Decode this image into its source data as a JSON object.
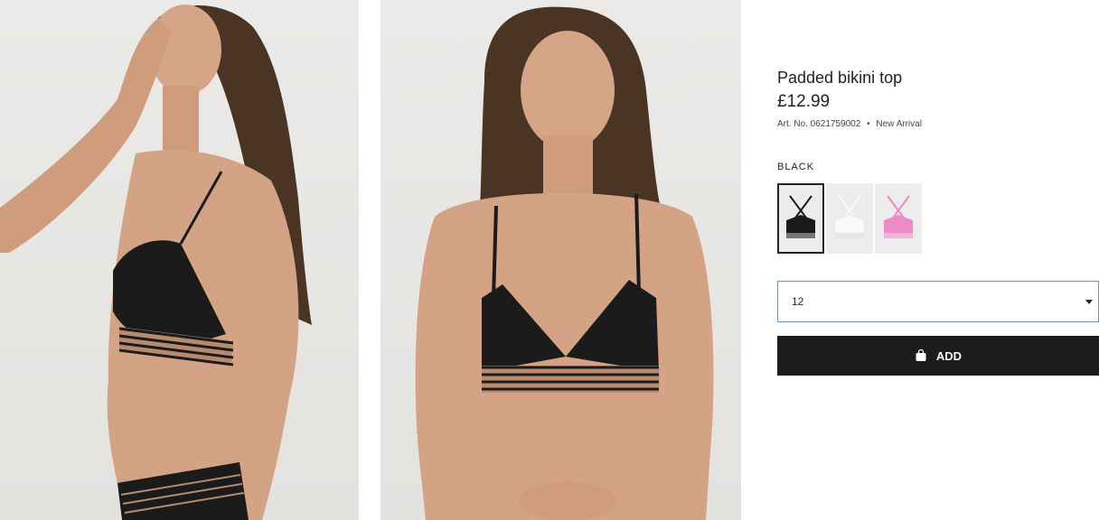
{
  "product": {
    "title": "Padded bikini top",
    "price": "£12.99",
    "article_number": "Art. No. 0621759002",
    "separator": "•",
    "badge": "New Arrival"
  },
  "color": {
    "selected_label": "BLACK",
    "swatches": [
      {
        "name": "black",
        "hex": "#1a1a1a",
        "selected": true
      },
      {
        "name": "white",
        "hex": "#f4f4f4",
        "selected": false
      },
      {
        "name": "pink",
        "hex": "#f08ac6",
        "selected": false
      }
    ]
  },
  "size": {
    "selected_value": "12"
  },
  "cart": {
    "add_label": "ADD",
    "icon": "shopping-bag-icon"
  },
  "images": [
    {
      "name": "model-side-view-photo"
    },
    {
      "name": "model-front-view-photo"
    }
  ]
}
